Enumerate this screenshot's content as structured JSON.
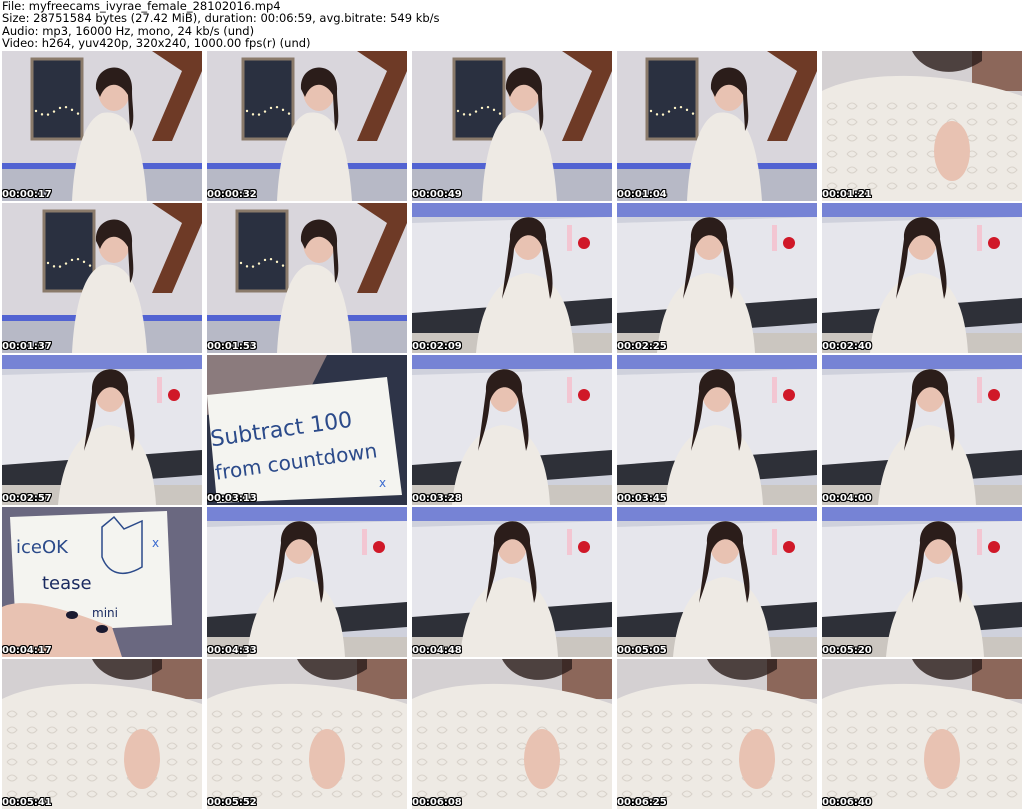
{
  "header": {
    "file_line": "File: myfreecams_ivyrae_female_28102016.mp4",
    "size_line": "Size: 28751584 bytes (27.42 MiB), duration: 00:06:59, avg.bitrate: 549 kb/s",
    "audio_line": "Audio: mp3, 16000 Hz, mono, 24 kb/s (und)",
    "video_line": "Video: h264, yuv420p, 320x240, 1000.00 fps(r) (und)"
  },
  "thumbnails": [
    {
      "time": "00:00:17",
      "scene": "room"
    },
    {
      "time": "00:00:32",
      "scene": "room"
    },
    {
      "time": "00:00:49",
      "scene": "room"
    },
    {
      "time": "00:01:04",
      "scene": "room"
    },
    {
      "time": "00:01:21",
      "scene": "closeup"
    },
    {
      "time": "00:01:37",
      "scene": "room"
    },
    {
      "time": "00:01:53",
      "scene": "room"
    },
    {
      "time": "00:02:09",
      "scene": "bed"
    },
    {
      "time": "00:02:25",
      "scene": "bed"
    },
    {
      "time": "00:02:40",
      "scene": "bed"
    },
    {
      "time": "00:02:57",
      "scene": "bed"
    },
    {
      "time": "00:03:13",
      "scene": "note1"
    },
    {
      "time": "00:03:28",
      "scene": "bed"
    },
    {
      "time": "00:03:45",
      "scene": "bed"
    },
    {
      "time": "00:04:00",
      "scene": "bed"
    },
    {
      "time": "00:04:17",
      "scene": "note2"
    },
    {
      "time": "00:04:33",
      "scene": "bed"
    },
    {
      "time": "00:04:48",
      "scene": "bed"
    },
    {
      "time": "00:05:05",
      "scene": "bed"
    },
    {
      "time": "00:05:20",
      "scene": "bed"
    },
    {
      "time": "00:05:41",
      "scene": "closeup"
    },
    {
      "time": "00:05:52",
      "scene": "closeup"
    },
    {
      "time": "00:06:08",
      "scene": "closeup"
    },
    {
      "time": "00:06:25",
      "scene": "closeup"
    },
    {
      "time": "00:06:40",
      "scene": "closeup"
    }
  ],
  "notes": {
    "note1_line1": "Subtract 100",
    "note1_line2": "from countdown",
    "note1_mark": "x",
    "note2_line1": "iceOK",
    "note2_line2": "tease",
    "note2_line3": "mini",
    "note2_mark": "x"
  },
  "colors": {
    "wall": "#d9d6dc",
    "window": "#2a3040",
    "beam": "#6e3a26",
    "sweater": "#eeeae4",
    "skin": "#e8c2b2",
    "hair": "#2b1d1a",
    "bed": "#e6e6ec",
    "blue_led": "#3a4fd0",
    "paper": "#f4f4f0",
    "ink": "#2b4a8a"
  }
}
